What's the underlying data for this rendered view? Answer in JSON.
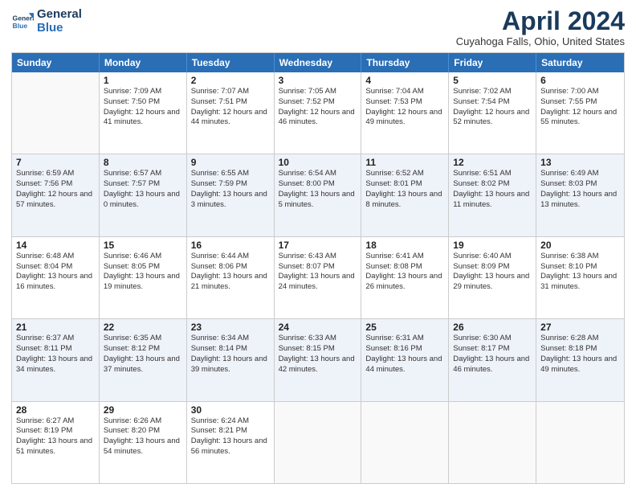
{
  "logo": {
    "line1": "General",
    "line2": "Blue"
  },
  "title": "April 2024",
  "location": "Cuyahoga Falls, Ohio, United States",
  "days": [
    "Sunday",
    "Monday",
    "Tuesday",
    "Wednesday",
    "Thursday",
    "Friday",
    "Saturday"
  ],
  "weeks": [
    [
      {
        "day": "",
        "sunrise": "",
        "sunset": "",
        "daylight": ""
      },
      {
        "day": "1",
        "sunrise": "Sunrise: 7:09 AM",
        "sunset": "Sunset: 7:50 PM",
        "daylight": "Daylight: 12 hours and 41 minutes."
      },
      {
        "day": "2",
        "sunrise": "Sunrise: 7:07 AM",
        "sunset": "Sunset: 7:51 PM",
        "daylight": "Daylight: 12 hours and 44 minutes."
      },
      {
        "day": "3",
        "sunrise": "Sunrise: 7:05 AM",
        "sunset": "Sunset: 7:52 PM",
        "daylight": "Daylight: 12 hours and 46 minutes."
      },
      {
        "day": "4",
        "sunrise": "Sunrise: 7:04 AM",
        "sunset": "Sunset: 7:53 PM",
        "daylight": "Daylight: 12 hours and 49 minutes."
      },
      {
        "day": "5",
        "sunrise": "Sunrise: 7:02 AM",
        "sunset": "Sunset: 7:54 PM",
        "daylight": "Daylight: 12 hours and 52 minutes."
      },
      {
        "day": "6",
        "sunrise": "Sunrise: 7:00 AM",
        "sunset": "Sunset: 7:55 PM",
        "daylight": "Daylight: 12 hours and 55 minutes."
      }
    ],
    [
      {
        "day": "7",
        "sunrise": "Sunrise: 6:59 AM",
        "sunset": "Sunset: 7:56 PM",
        "daylight": "Daylight: 12 hours and 57 minutes."
      },
      {
        "day": "8",
        "sunrise": "Sunrise: 6:57 AM",
        "sunset": "Sunset: 7:57 PM",
        "daylight": "Daylight: 13 hours and 0 minutes."
      },
      {
        "day": "9",
        "sunrise": "Sunrise: 6:55 AM",
        "sunset": "Sunset: 7:59 PM",
        "daylight": "Daylight: 13 hours and 3 minutes."
      },
      {
        "day": "10",
        "sunrise": "Sunrise: 6:54 AM",
        "sunset": "Sunset: 8:00 PM",
        "daylight": "Daylight: 13 hours and 5 minutes."
      },
      {
        "day": "11",
        "sunrise": "Sunrise: 6:52 AM",
        "sunset": "Sunset: 8:01 PM",
        "daylight": "Daylight: 13 hours and 8 minutes."
      },
      {
        "day": "12",
        "sunrise": "Sunrise: 6:51 AM",
        "sunset": "Sunset: 8:02 PM",
        "daylight": "Daylight: 13 hours and 11 minutes."
      },
      {
        "day": "13",
        "sunrise": "Sunrise: 6:49 AM",
        "sunset": "Sunset: 8:03 PM",
        "daylight": "Daylight: 13 hours and 13 minutes."
      }
    ],
    [
      {
        "day": "14",
        "sunrise": "Sunrise: 6:48 AM",
        "sunset": "Sunset: 8:04 PM",
        "daylight": "Daylight: 13 hours and 16 minutes."
      },
      {
        "day": "15",
        "sunrise": "Sunrise: 6:46 AM",
        "sunset": "Sunset: 8:05 PM",
        "daylight": "Daylight: 13 hours and 19 minutes."
      },
      {
        "day": "16",
        "sunrise": "Sunrise: 6:44 AM",
        "sunset": "Sunset: 8:06 PM",
        "daylight": "Daylight: 13 hours and 21 minutes."
      },
      {
        "day": "17",
        "sunrise": "Sunrise: 6:43 AM",
        "sunset": "Sunset: 8:07 PM",
        "daylight": "Daylight: 13 hours and 24 minutes."
      },
      {
        "day": "18",
        "sunrise": "Sunrise: 6:41 AM",
        "sunset": "Sunset: 8:08 PM",
        "daylight": "Daylight: 13 hours and 26 minutes."
      },
      {
        "day": "19",
        "sunrise": "Sunrise: 6:40 AM",
        "sunset": "Sunset: 8:09 PM",
        "daylight": "Daylight: 13 hours and 29 minutes."
      },
      {
        "day": "20",
        "sunrise": "Sunrise: 6:38 AM",
        "sunset": "Sunset: 8:10 PM",
        "daylight": "Daylight: 13 hours and 31 minutes."
      }
    ],
    [
      {
        "day": "21",
        "sunrise": "Sunrise: 6:37 AM",
        "sunset": "Sunset: 8:11 PM",
        "daylight": "Daylight: 13 hours and 34 minutes."
      },
      {
        "day": "22",
        "sunrise": "Sunrise: 6:35 AM",
        "sunset": "Sunset: 8:12 PM",
        "daylight": "Daylight: 13 hours and 37 minutes."
      },
      {
        "day": "23",
        "sunrise": "Sunrise: 6:34 AM",
        "sunset": "Sunset: 8:14 PM",
        "daylight": "Daylight: 13 hours and 39 minutes."
      },
      {
        "day": "24",
        "sunrise": "Sunrise: 6:33 AM",
        "sunset": "Sunset: 8:15 PM",
        "daylight": "Daylight: 13 hours and 42 minutes."
      },
      {
        "day": "25",
        "sunrise": "Sunrise: 6:31 AM",
        "sunset": "Sunset: 8:16 PM",
        "daylight": "Daylight: 13 hours and 44 minutes."
      },
      {
        "day": "26",
        "sunrise": "Sunrise: 6:30 AM",
        "sunset": "Sunset: 8:17 PM",
        "daylight": "Daylight: 13 hours and 46 minutes."
      },
      {
        "day": "27",
        "sunrise": "Sunrise: 6:28 AM",
        "sunset": "Sunset: 8:18 PM",
        "daylight": "Daylight: 13 hours and 49 minutes."
      }
    ],
    [
      {
        "day": "28",
        "sunrise": "Sunrise: 6:27 AM",
        "sunset": "Sunset: 8:19 PM",
        "daylight": "Daylight: 13 hours and 51 minutes."
      },
      {
        "day": "29",
        "sunrise": "Sunrise: 6:26 AM",
        "sunset": "Sunset: 8:20 PM",
        "daylight": "Daylight: 13 hours and 54 minutes."
      },
      {
        "day": "30",
        "sunrise": "Sunrise: 6:24 AM",
        "sunset": "Sunset: 8:21 PM",
        "daylight": "Daylight: 13 hours and 56 minutes."
      },
      {
        "day": "",
        "sunrise": "",
        "sunset": "",
        "daylight": ""
      },
      {
        "day": "",
        "sunrise": "",
        "sunset": "",
        "daylight": ""
      },
      {
        "day": "",
        "sunrise": "",
        "sunset": "",
        "daylight": ""
      },
      {
        "day": "",
        "sunrise": "",
        "sunset": "",
        "daylight": ""
      }
    ]
  ]
}
